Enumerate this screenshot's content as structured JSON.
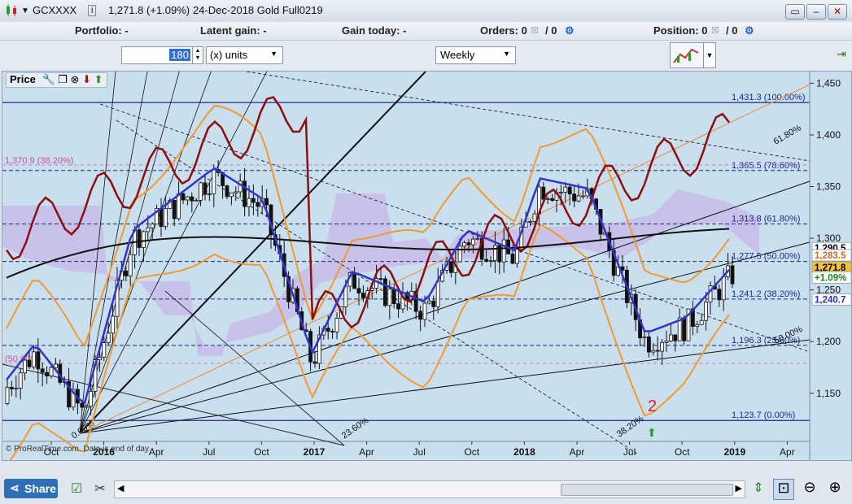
{
  "window": {
    "symbol": "GCXXXX",
    "price": "1,271.8 (+1.09%)",
    "description": "24-Dec-2018 Gold Full0219"
  },
  "infobar": {
    "portfolio": "Portfolio: -",
    "latent_gain": "Latent gain: -",
    "gain_today": "Gain today: -",
    "orders": "Orders: 0",
    "orders_count": "/ 0",
    "position": "Position: 0",
    "position_count": "/ 0"
  },
  "toolbar": {
    "units_value": "180",
    "units_label": "(x) units",
    "timeframe": "Weekly"
  },
  "chart": {
    "panel_title": "Price",
    "copyright": "© ProRealTime.com. Data is end of day",
    "y_ticks": [
      "1,450",
      "1,400",
      "1,350",
      "1,300",
      "1,250",
      "1,200",
      "1,150"
    ],
    "y_range": [
      1105,
      1455
    ],
    "x_ticks": [
      "Oct",
      "2016",
      "Apr",
      "Jul",
      "Oct",
      "2017",
      "Apr",
      "Jul",
      "Oct",
      "2018",
      "Apr",
      "Jul",
      "Oct",
      "2019",
      "Apr"
    ],
    "fib_levels": [
      {
        "label": "1,431.3 (100.00%)",
        "value": 1431.3
      },
      {
        "label": "1,365.5 (78.60%)",
        "value": 1365.5
      },
      {
        "label": "1,313.8 (61.80%)",
        "value": 1313.8
      },
      {
        "label": "1,277.5 (50.00%)",
        "value": 1277.5
      },
      {
        "label": "1,241.2 (38.20%)",
        "value": 1241.2
      },
      {
        "label": "1,196.3 (23.60%)",
        "value": 1196.3
      },
      {
        "label": "1,123.7 (0.00%)",
        "value": 1123.7
      }
    ],
    "left_fib_labels": [
      {
        "label": "1,370.9 (38.20%)",
        "value": 1370.9
      },
      {
        "label": "(50.00%)",
        "value": 1179
      }
    ],
    "fan_labels": [
      "61.80%",
      "50.00%",
      "23.60%",
      "38.20%",
      "0.00%"
    ],
    "wave_label": "2",
    "price_tags": [
      {
        "label": "1,290.5",
        "value": 1290.5,
        "color": "#ffffff",
        "text": "#000000"
      },
      {
        "label": "1,283.5",
        "value": 1283.5,
        "color": "#ffffff",
        "text": "#d2691e"
      },
      {
        "label": "1,271.8",
        "value": 1271.8,
        "color": "#f2c230",
        "text": "#000000"
      },
      {
        "label": "+1.09%",
        "value": 1262,
        "color": "#ffffff",
        "text": "#1a8a1a"
      },
      {
        "label": "1,240.7",
        "value": 1240.7,
        "color": "#ffffff",
        "text": "#2233cc"
      }
    ]
  },
  "bottombar": {
    "share_label": "Share"
  },
  "colors": {
    "chart_bg": "#c9dfee",
    "fib_line": "#1c2a8c",
    "rsi_line": "#8b0f0f",
    "bollinger": "#f39a2e",
    "ma_blue": "#3333cc",
    "ma_black": "#111111",
    "cloud": "#c6a8e6"
  }
}
